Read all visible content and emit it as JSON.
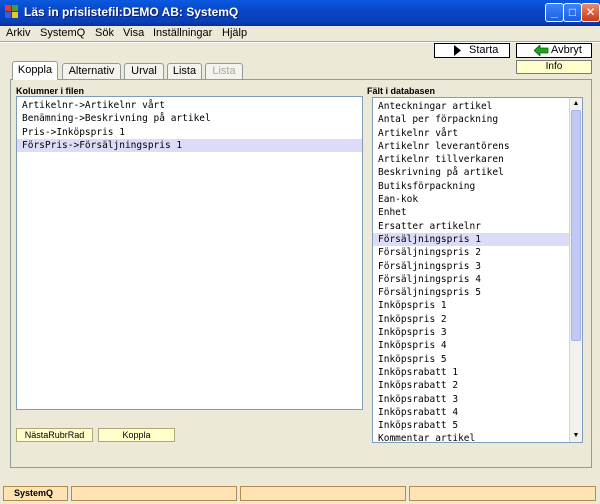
{
  "window": {
    "title": "Läs in prislistefil:DEMO AB: SystemQ"
  },
  "menubar": {
    "items": [
      "Arkiv",
      "SystemQ",
      "Sök",
      "Visa",
      "Inställningar",
      "Hjälp"
    ]
  },
  "toolbar": {
    "start_label": "Starta",
    "cancel_label": "Avbryt",
    "info_label": "Info"
  },
  "tabs": [
    "Koppla",
    "Alternativ",
    "Urval",
    "Lista",
    "Lista"
  ],
  "left_panel": {
    "heading": "Kolumner i filen",
    "items": [
      "Artikelnr->Artikelnr vårt",
      "Benämning->Beskrivning på artikel",
      "Pris->Inköpspris 1",
      "FörsPris->Försäljningspris 1"
    ],
    "selected_index": 3
  },
  "right_panel": {
    "heading": "Fält i databasen",
    "items": [
      "Anteckningar artikel",
      "Antal per förpackning",
      "Artikelnr vårt",
      "Artikelnr leverantörens",
      "Artikelnr tillverkaren",
      "Beskrivning på artikel",
      "Butiksförpackning",
      "Ean-kok",
      "Enhet",
      "Ersatter artikelnr",
      "Försäljningspris 1",
      "Försäljningspris 2",
      "Försäljningspris 3",
      "Försäljningspris 4",
      "Försäljningspris 5",
      "Inköpspris 1",
      "Inköpspris 2",
      "Inköpspris 3",
      "Inköpspris 4",
      "Inköpspris 5",
      "Inköpsrabatt 1",
      "Inköpsrabatt 2",
      "Inköpsrabatt 3",
      "Inköpsrabatt 4",
      "Inköpsrabatt 5",
      "Kommentar artikel"
    ],
    "selected_index": 10
  },
  "buttons": {
    "next_header_row": "NästaRubrRad",
    "connect": "Koppla"
  },
  "statusbar": {
    "app_label": "SystemQ"
  },
  "colors": {
    "titlebar": "#0a5ae0",
    "selection": "#dcdcf8",
    "info_yellow": "#ffffcc",
    "status_orange": "#ffe3b3"
  }
}
